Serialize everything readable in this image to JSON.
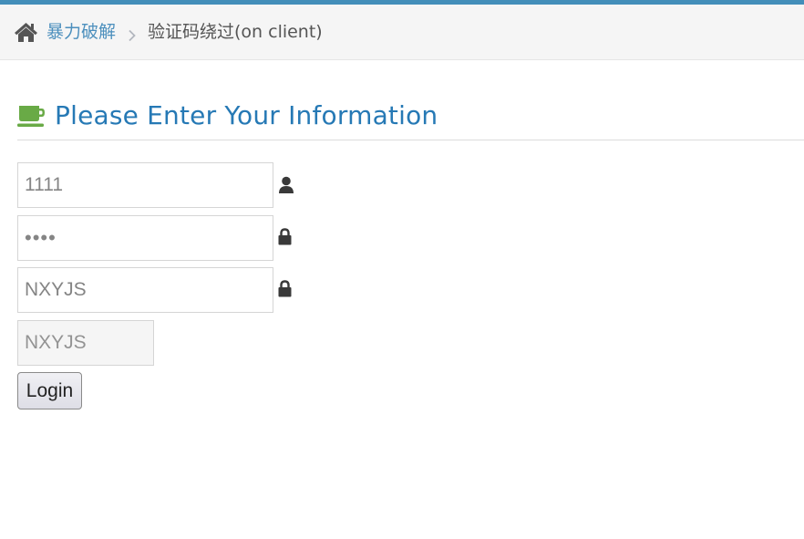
{
  "breadcrumb": {
    "home_icon": "home-icon",
    "parent_label": "暴力破解",
    "separator_icon": "chevron-right-icon",
    "current_label": "验证码绕过(on client)"
  },
  "header": {
    "icon": "coffee-icon",
    "title": "Please Enter Your Information"
  },
  "form": {
    "username": {
      "value": "1111",
      "icon": "user-icon"
    },
    "password": {
      "value": "1111",
      "icon": "lock-icon"
    },
    "captcha_input": {
      "value": "NXYJS",
      "icon": "lock-icon"
    },
    "captcha_code": {
      "value": "NXYJS"
    },
    "login_label": "Login"
  },
  "colors": {
    "accent_bar": "#438eb9",
    "link": "#4c8fbd",
    "title": "#2679b5",
    "coffee_icon": "#69aa46"
  }
}
